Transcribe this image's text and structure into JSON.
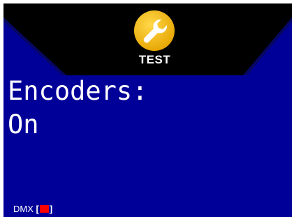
{
  "header": {
    "icon": "wrench-icon",
    "label": "TEST"
  },
  "display": {
    "line1": "Encoders:",
    "line2": "On"
  },
  "status": {
    "dmx_label": "DMX",
    "dmx_open": "[",
    "dmx_close": "]",
    "dmx_indicator_color": "#ff0000"
  },
  "colors": {
    "background": "#000099",
    "header": "#000000",
    "icon": "#f5b800",
    "text": "#ffffff"
  }
}
